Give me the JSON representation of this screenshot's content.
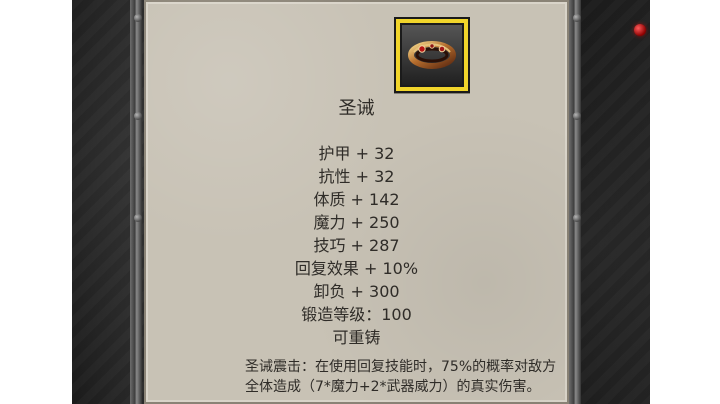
{
  "item": {
    "icon": "ring-icon",
    "name": "圣诫",
    "stats": [
      "护甲 + 32",
      "抗性 + 32",
      "体质 + 142",
      "魔力 + 250",
      "技巧 + 287",
      "回复效果 + 10%",
      "卸负 + 300",
      "锻造等级：100",
      "可重铸"
    ],
    "description_lines": [
      "圣诫震击：在使用回复技能时，75%的概率对敌方",
      "全体造成（7*魔力+2*武器威力）的真实伤害。"
    ]
  },
  "colors": {
    "panel": "#c8c2b5",
    "icon_border": "#f1d52b",
    "text": "#2f2c28"
  }
}
